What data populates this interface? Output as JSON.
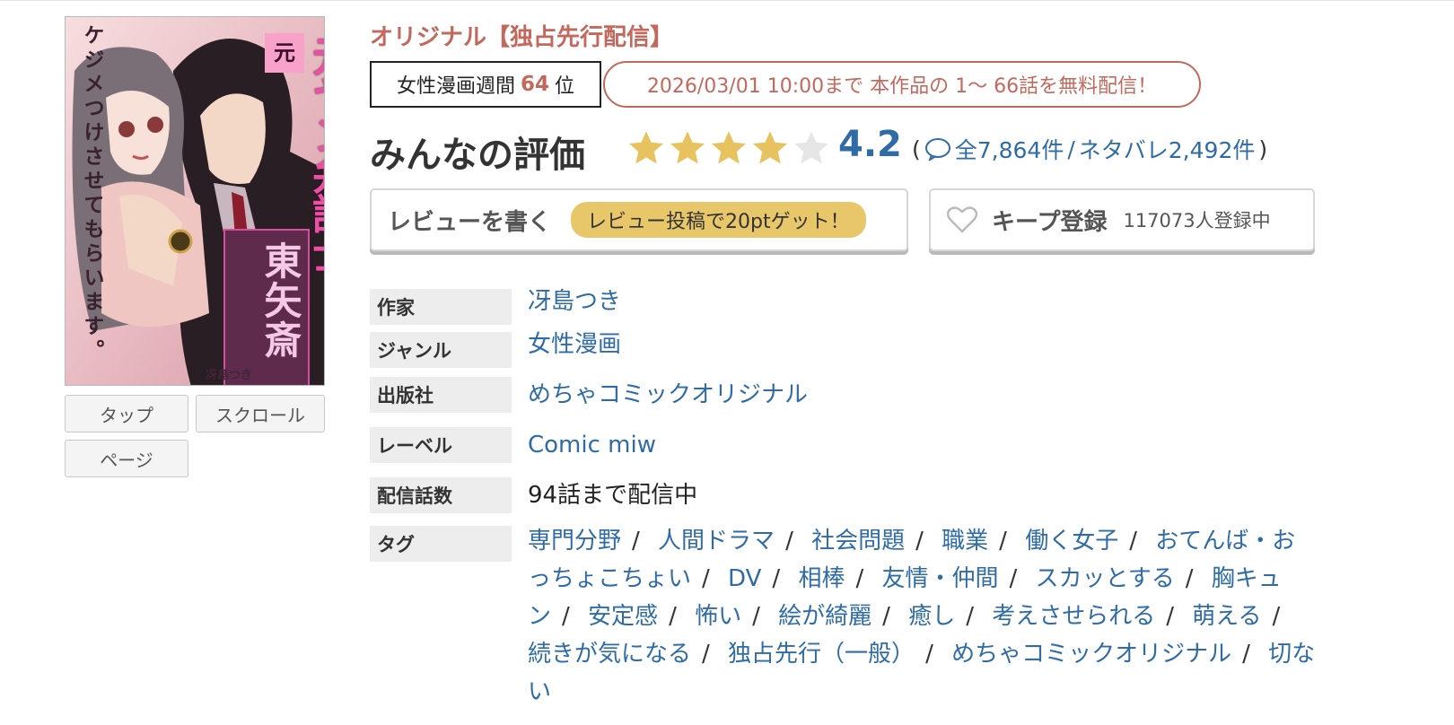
{
  "cover": {
    "tagline": "ケジメつけさせてもらいます。",
    "title": "元ヤン弁護士",
    "label": "東矢斎",
    "author": "冴島つき",
    "badge": "元"
  },
  "view_modes": {
    "tap": "タップ",
    "scroll": "スクロール",
    "page": "ページ"
  },
  "header": {
    "original_label": "オリジナル【独占先行配信】"
  },
  "ranking": {
    "prefix": "女性漫画週間",
    "rank": "64",
    "suffix": "位"
  },
  "free_notice": "2026/03/01 10:00まで 本作品の 1〜 66話を無料配信！",
  "rating": {
    "title": "みんなの評価",
    "score": "4.2",
    "stars_filled": 4,
    "stars_total": 5,
    "open_paren": "(",
    "close_paren": ")",
    "reviews": "全7,864件",
    "divider": "/",
    "spoilers": "ネタバレ2,492件"
  },
  "review_button": {
    "label": "レビューを書く",
    "badge": "レビュー投稿で20ptゲット！"
  },
  "keep_button": {
    "label": "キープ登録",
    "count": "117073人登録中"
  },
  "info": {
    "author_label": "作家",
    "author_value": "冴島つき",
    "genre_label": "ジャンル",
    "genre_value": "女性漫画",
    "publisher_label": "出版社",
    "publisher_value": "めちゃコミックオリジナル",
    "label_label": "レーベル",
    "label_value": "Comic miw",
    "episodes_label": "配信話数",
    "episodes_value": "94話まで配信中",
    "tags_label": "タグ"
  },
  "tags": [
    "専門分野",
    "人間ドラマ",
    "社会問題",
    "職業",
    "働く女子",
    "おてんば・おっちょこちょい",
    "DV",
    "相棒",
    "友情・仲間",
    "スカッとする",
    "胸キュン",
    "安定感",
    "怖い",
    "絵が綺麗",
    "癒し",
    "考えさせられる",
    "萌える",
    "続きが気になる",
    "独占先行（一般）",
    "めちゃコミックオリジナル",
    "切ない"
  ],
  "colors": {
    "accent_red": "#c4685e",
    "link_blue": "#2f6ca7",
    "star_gold": "#e8c25e",
    "star_empty": "#e6e6e6"
  },
  "icons": {
    "comment": "speech-bubble-icon",
    "heart": "heart-icon",
    "star": "star-icon"
  }
}
